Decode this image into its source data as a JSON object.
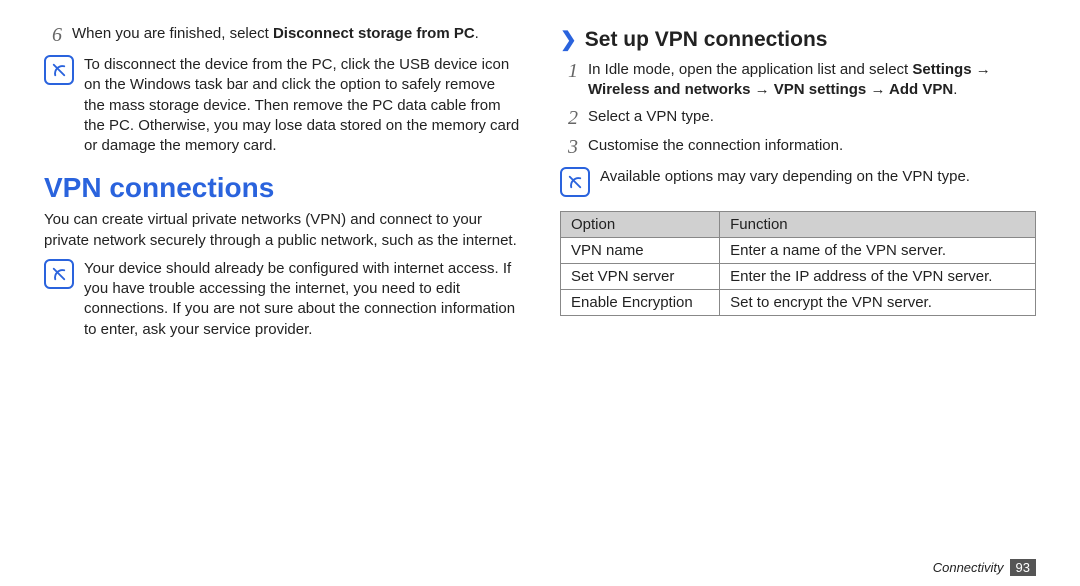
{
  "left": {
    "step6_num": "6",
    "step6_text_a": "When you are finished, select ",
    "step6_bold": "Disconnect storage from PC",
    "step6_text_b": ".",
    "note1": "To disconnect the device from the PC, click the USB device icon on the Windows task bar and click the option to safely remove the mass storage device. Then remove the PC data cable from the PC. Otherwise, you may lose data stored on the memory card or damage the memory card.",
    "h1": "VPN connections",
    "intro": "You can create virtual private networks (VPN) and connect to your private network securely through a public network, such as the internet.",
    "note2": "Your device should already be configured with internet access. If you have trouble accessing the internet, you need to edit connections. If you are not sure about the connection information to enter, ask your service provider."
  },
  "right": {
    "subhead": "Set up VPN connections",
    "step1_num": "1",
    "step1_a": "In Idle mode, open the application list and select ",
    "step1_bold": "Settings → Wireless and networks → VPN settings → Add VPN",
    "step1_b": ".",
    "step2_num": "2",
    "step2": "Select a VPN type.",
    "step3_num": "3",
    "step3": "Customise the connection information.",
    "note3": "Available options may vary depending on the VPN type.",
    "table": {
      "h1": "Option",
      "h2": "Function",
      "rows": [
        {
          "opt": "VPN name",
          "fn": "Enter a name of the VPN server."
        },
        {
          "opt": "Set VPN server",
          "fn": "Enter the IP address of the VPN server."
        },
        {
          "opt": "Enable Encryption",
          "fn": "Set to encrypt the VPN server."
        }
      ]
    }
  },
  "footer": {
    "section": "Connectivity",
    "page": "93"
  }
}
